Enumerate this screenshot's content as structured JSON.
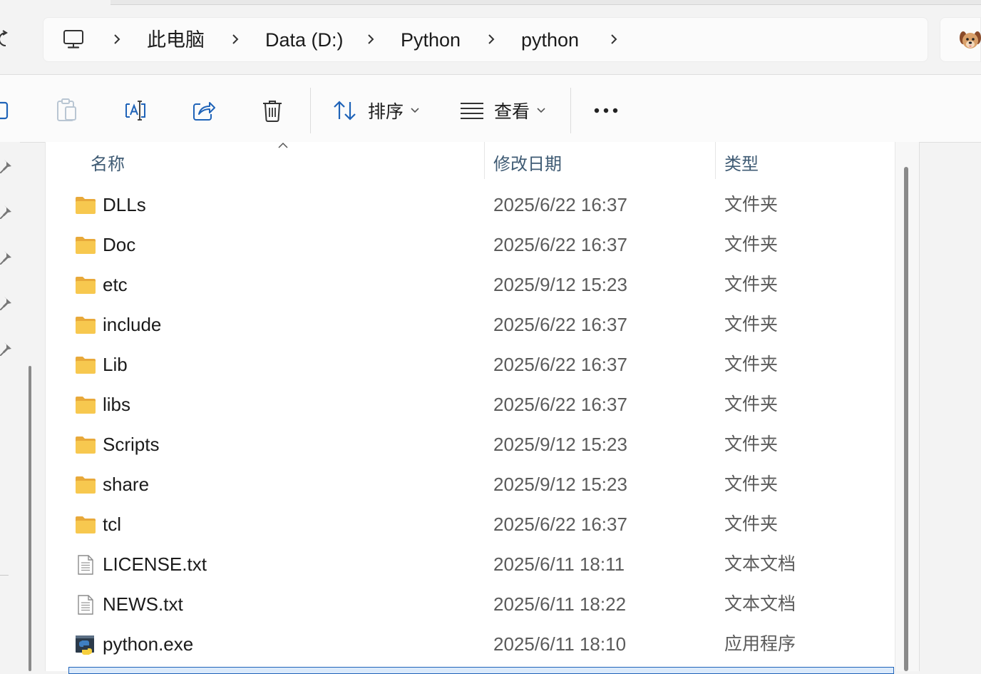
{
  "breadcrumb": {
    "items": [
      "此电脑",
      "Data (D:)",
      "Python",
      "python"
    ]
  },
  "toolbar": {
    "sort_label": "排序",
    "view_label": "查看",
    "more_label": "•••"
  },
  "columns": {
    "name": "名称",
    "modified": "修改日期",
    "type": "类型"
  },
  "files": [
    {
      "name": "DLLs",
      "modified": "2025/6/22 16:37",
      "type": "文件夹",
      "icon": "folder-icon"
    },
    {
      "name": "Doc",
      "modified": "2025/6/22 16:37",
      "type": "文件夹",
      "icon": "folder-icon"
    },
    {
      "name": "etc",
      "modified": "2025/9/12 15:23",
      "type": "文件夹",
      "icon": "folder-icon"
    },
    {
      "name": "include",
      "modified": "2025/6/22 16:37",
      "type": "文件夹",
      "icon": "folder-icon"
    },
    {
      "name": "Lib",
      "modified": "2025/6/22 16:37",
      "type": "文件夹",
      "icon": "folder-icon"
    },
    {
      "name": "libs",
      "modified": "2025/6/22 16:37",
      "type": "文件夹",
      "icon": "folder-icon"
    },
    {
      "name": "Scripts",
      "modified": "2025/9/12 15:23",
      "type": "文件夹",
      "icon": "folder-icon"
    },
    {
      "name": "share",
      "modified": "2025/9/12 15:23",
      "type": "文件夹",
      "icon": "folder-icon"
    },
    {
      "name": "tcl",
      "modified": "2025/6/22 16:37",
      "type": "文件夹",
      "icon": "folder-icon"
    },
    {
      "name": "LICENSE.txt",
      "modified": "2025/6/11 18:11",
      "type": "文本文档",
      "icon": "text-file-icon"
    },
    {
      "name": "NEWS.txt",
      "modified": "2025/6/11 18:22",
      "type": "文本文档",
      "icon": "text-file-icon"
    },
    {
      "name": "python.exe",
      "modified": "2025/6/11 18:10",
      "type": "应用程序",
      "icon": "python-exe-icon"
    }
  ],
  "colors": {
    "accent": "#1f63b8",
    "folder": "#f5c24a",
    "header_text": "#3f5b74"
  }
}
